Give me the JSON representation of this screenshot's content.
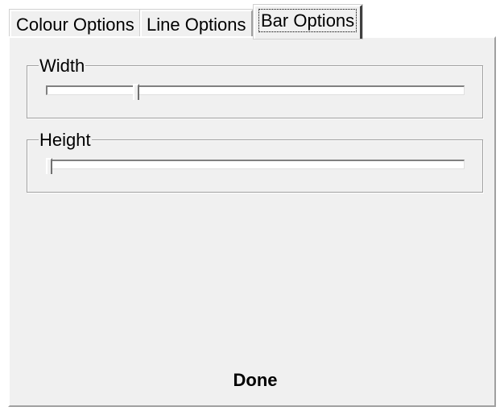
{
  "tabs": [
    {
      "label": "Colour Options",
      "active": false
    },
    {
      "label": "Line Options",
      "active": false
    },
    {
      "label": "Bar Options",
      "active": true
    }
  ],
  "bar_options": {
    "width": {
      "label": "Width",
      "value_fraction": 0.21
    },
    "height": {
      "label": "Height",
      "value_fraction": 0.0
    }
  },
  "actions": {
    "done_label": "Done"
  },
  "colors": {
    "panel_background": "#f0f0f0",
    "slider_track": "#ffffff"
  }
}
